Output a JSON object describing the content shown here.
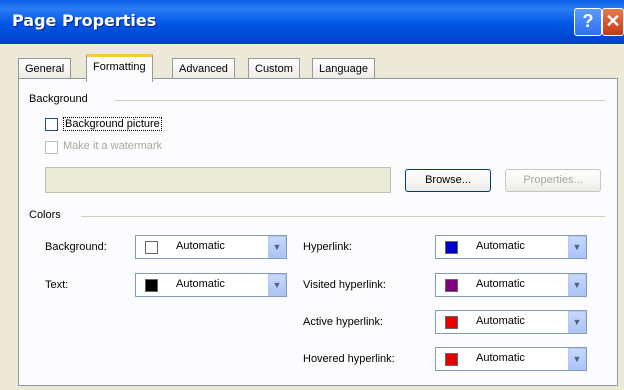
{
  "window": {
    "title": "Page Properties",
    "help_label": "?",
    "close_label": "✕"
  },
  "tabs": [
    "General",
    "Formatting",
    "Advanced",
    "Custom",
    "Language"
  ],
  "background_section": {
    "heading": "Background",
    "picture_checkbox": "Background picture",
    "watermark_checkbox": "Make it a watermark",
    "path_value": "",
    "browse_button": "Browse...",
    "properties_button": "Properties..."
  },
  "colors_section": {
    "heading": "Colors",
    "background": {
      "label": "Background:",
      "value": "Automatic",
      "color": "#ffffff"
    },
    "text": {
      "label": "Text:",
      "value": "Automatic",
      "color": "#000000"
    },
    "hyperlink": {
      "label": "Hyperlink:",
      "value": "Automatic",
      "color": "#0000cc"
    },
    "visited_hyperlink": {
      "label": "Visited hyperlink:",
      "value": "Automatic",
      "color": "#800080"
    },
    "active_hyperlink": {
      "label": "Active hyperlink:",
      "value": "Automatic",
      "color": "#e60000"
    },
    "hovered_hyperlink": {
      "label": "Hovered hyperlink:",
      "value": "Automatic",
      "color": "#e60000"
    }
  }
}
